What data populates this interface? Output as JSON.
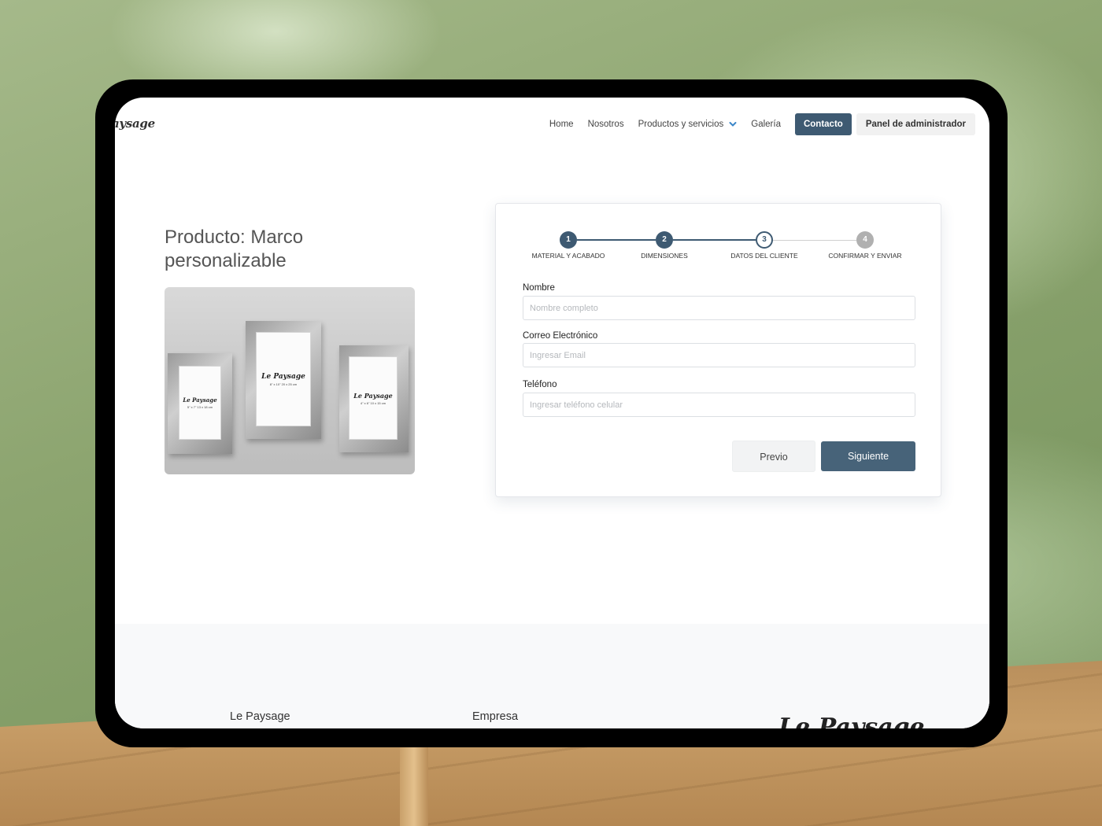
{
  "nav": {
    "logo": "aysage",
    "links": [
      "Home",
      "Nosotros",
      "Productos y servicios",
      "Galería"
    ],
    "contact_label": "Contacto",
    "admin_label": "Panel de administrador"
  },
  "product": {
    "title": "Producto: Marco personalizable",
    "image_frames": [
      {
        "brand": "Le Paysage",
        "size": "5\" x 7\" 13 x 18 cm"
      },
      {
        "brand": "Le Paysage",
        "size": "8\" x 10\" 20 x 25 cm"
      },
      {
        "brand": "Le Paysage",
        "size": "4\" x 6\" 10 x 15 cm"
      }
    ]
  },
  "stepper": {
    "steps": [
      {
        "number": "1",
        "label": "MATERIAL Y ACABADO",
        "state": "done"
      },
      {
        "number": "2",
        "label": "DIMENSIONES",
        "state": "done"
      },
      {
        "number": "3",
        "label": "DATOS DEL CLIENTE",
        "state": "current"
      },
      {
        "number": "4",
        "label": "CONFIRMAR Y ENVIAR",
        "state": "pending"
      }
    ]
  },
  "form": {
    "name_label": "Nombre",
    "name_placeholder": "Nombre completo",
    "email_label": "Correo Electrónico",
    "email_placeholder": "Ingresar Email",
    "phone_label": "Teléfono",
    "phone_placeholder": "Ingresar teléfono celular",
    "prev_label": "Previo",
    "next_label": "Siguiente"
  },
  "footer": {
    "col1_title": "Le Paysage",
    "col2_title": "Empresa",
    "logo": "Le Paysage"
  },
  "colors": {
    "accent": "#3e5a72",
    "button_next": "#476379",
    "step_pending": "#b0b0b0"
  }
}
